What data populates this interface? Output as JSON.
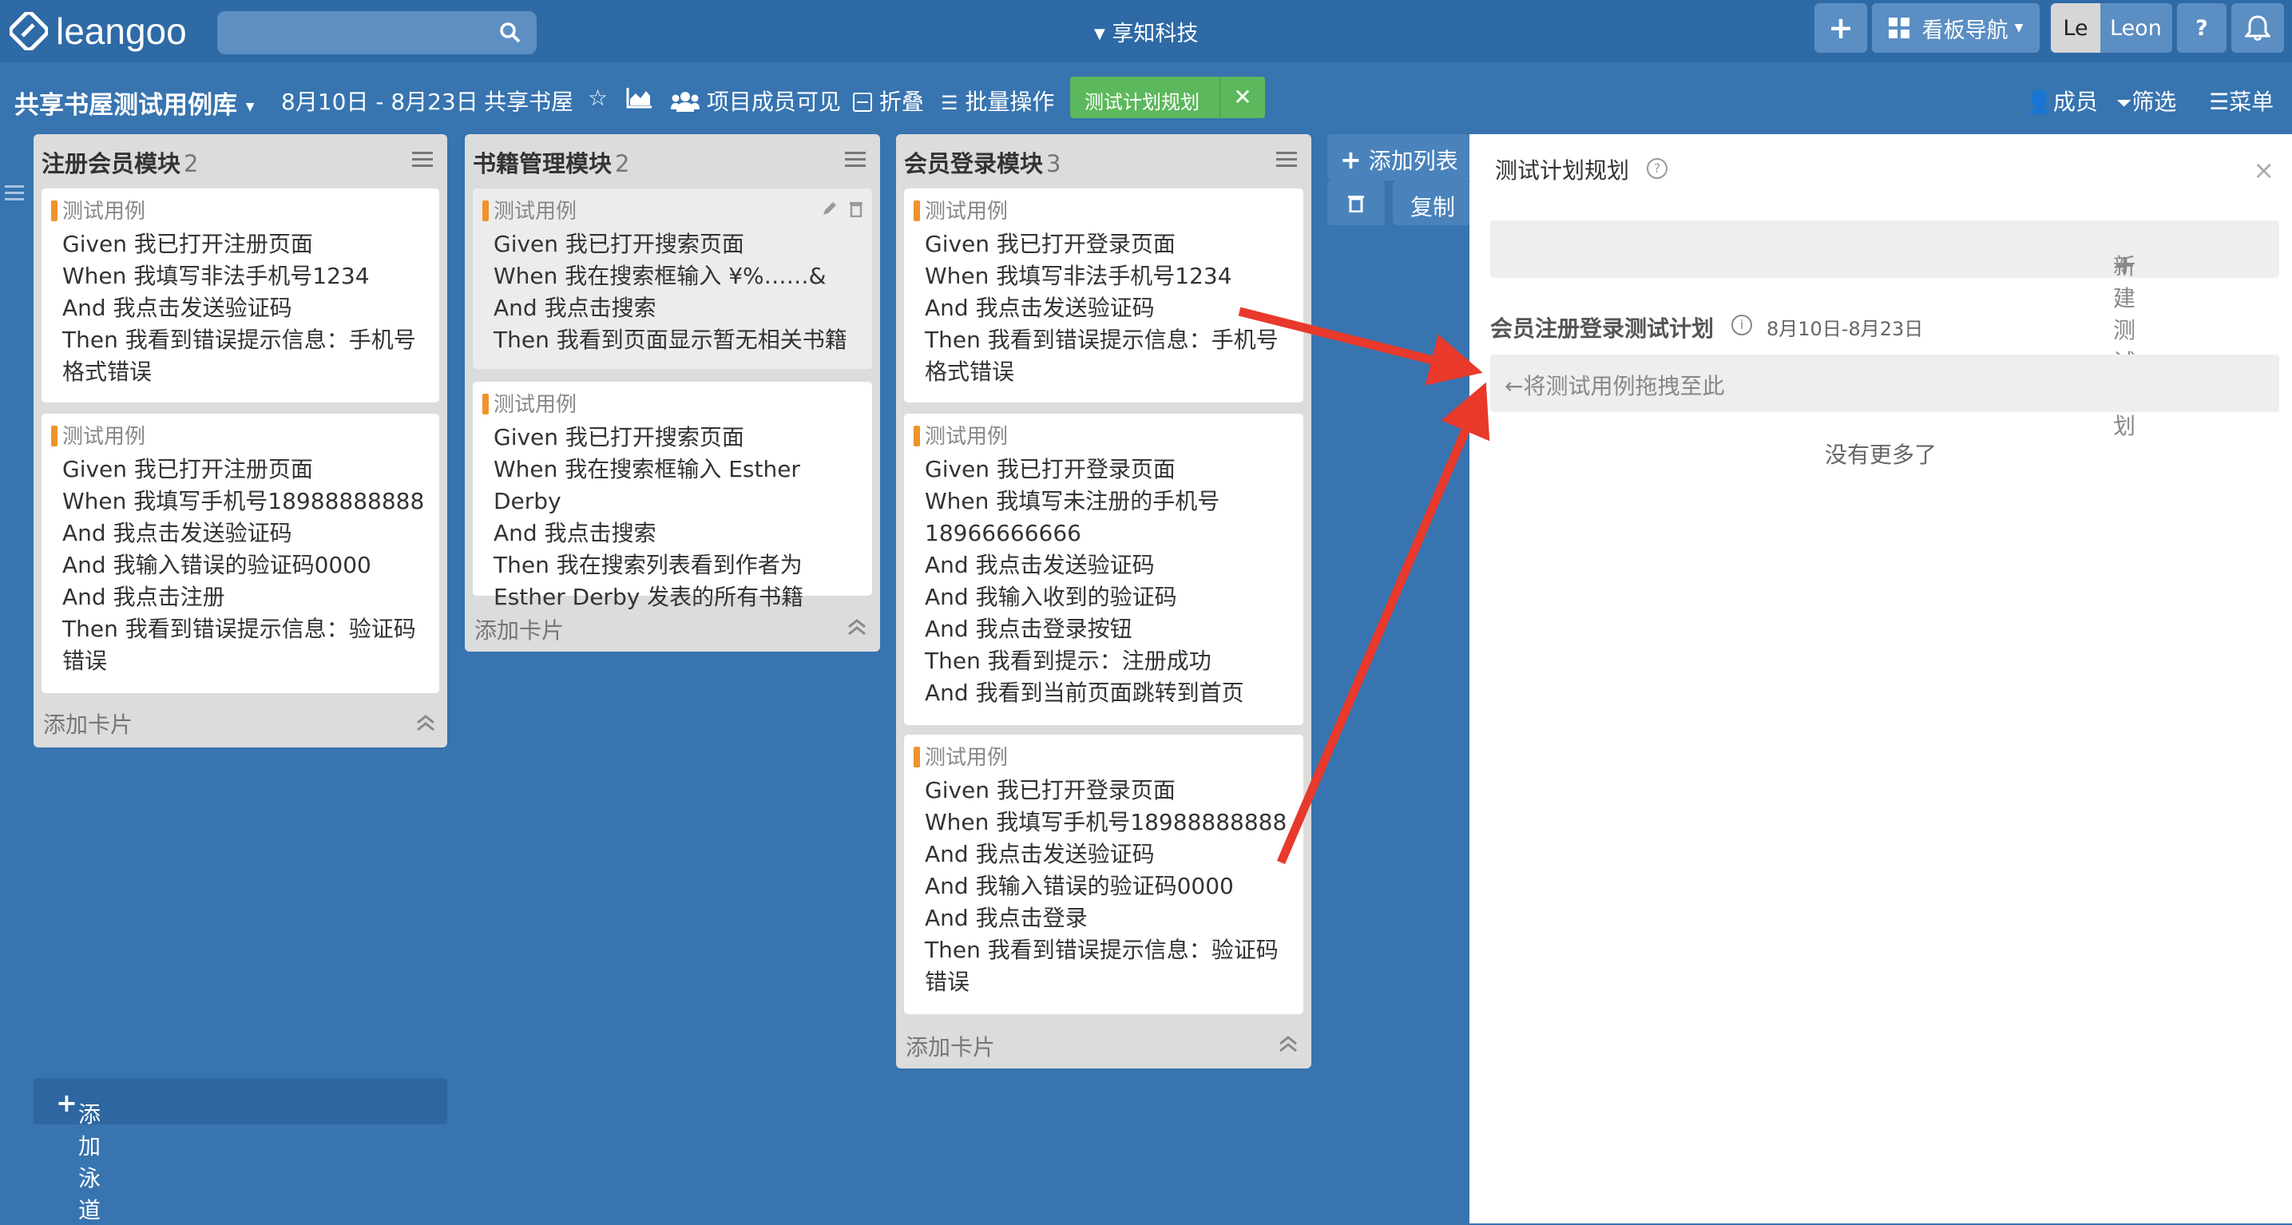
{
  "header": {
    "logo_text": "leangoo",
    "org_name": "享知科技",
    "board_nav_label": "看板导航",
    "avatar_initials": "Le",
    "user_name": "Leon"
  },
  "subbar": {
    "board_title": "共享书屋测试用例库",
    "date_range": "8月10日 - 8月23日",
    "project_name": "共享书屋",
    "visibility": "项目成员可见",
    "fold": "折叠",
    "batch": "批量操作",
    "active_panel": "测试计划规划",
    "members": "成员",
    "filter": "筛选",
    "menu": "菜单"
  },
  "columns": [
    {
      "title": "注册会员模块",
      "count": "2",
      "add_card": "添加卡片",
      "cards": [
        {
          "tag": "测试用例",
          "lines": [
            "Given 我已打开注册页面",
            "When 我填写非法手机号1234",
            "And 我点击发送验证码",
            "Then 我看到错误提示信息：手机号格式错误"
          ]
        },
        {
          "tag": "测试用例",
          "lines": [
            "Given 我已打开注册页面",
            "When 我填写手机号18988888888",
            "And 我点击发送验证码",
            "And 我输入错误的验证码0000",
            "And 我点击注册",
            "Then 我看到错误提示信息：验证码错误"
          ]
        }
      ]
    },
    {
      "title": "书籍管理模块",
      "count": "2",
      "add_card": "添加卡片",
      "cards": [
        {
          "tag": "测试用例",
          "lines": [
            "Given 我已打开搜索页面",
            "When 我在搜索框输入 ¥%……&",
            "And 我点击搜索",
            "Then 我看到页面显示暂无相关书籍"
          ]
        },
        {
          "tag": "测试用例",
          "lines": [
            "Given 我已打开搜索页面",
            "When 我在搜索框输入 Esther Derby",
            "And 我点击搜索",
            "Then 我在搜索列表看到作者为 Esther Derby 发表的所有书籍"
          ]
        }
      ]
    },
    {
      "title": "会员登录模块",
      "count": "3",
      "add_card": "添加卡片",
      "cards": [
        {
          "tag": "测试用例",
          "lines": [
            "Given 我已打开登录页面",
            "When 我填写非法手机号1234",
            "And 我点击发送验证码",
            "Then 我看到错误提示信息：手机号格式错误"
          ]
        },
        {
          "tag": "测试用例",
          "lines": [
            "Given 我已打开登录页面",
            "When 我填写未注册的手机号18966666666",
            "And 我点击发送验证码",
            "And 我输入收到的验证码",
            "And 我点击登录按钮",
            "Then 我看到提示：注册成功",
            "And 我看到当前页面跳转到首页"
          ]
        },
        {
          "tag": "测试用例",
          "lines": [
            "Given 我已打开登录页面",
            "When 我填写手机号18988888888",
            "And 我点击发送验证码",
            "And 我输入错误的验证码0000",
            "And 我点击登录",
            "Then 我看到错误提示信息：验证码错误"
          ]
        }
      ]
    }
  ],
  "add_list": "添加列表",
  "copy": "复制",
  "add_lane": "添加泳道",
  "panel": {
    "title": "测试计划规划",
    "new_plan": "新建测试计划",
    "plan_name": "会员注册登录测试计划",
    "plan_date": "8月10日-8月23日",
    "drop_hint": "←将测试用例拖拽至此",
    "no_more": "没有更多了"
  },
  "colors": {
    "nav": "#2e6aa6",
    "board": "#3774b0",
    "accent_green": "#5cb85c",
    "tag_orange": "#f0922b",
    "arrow_red": "#e8392b"
  }
}
